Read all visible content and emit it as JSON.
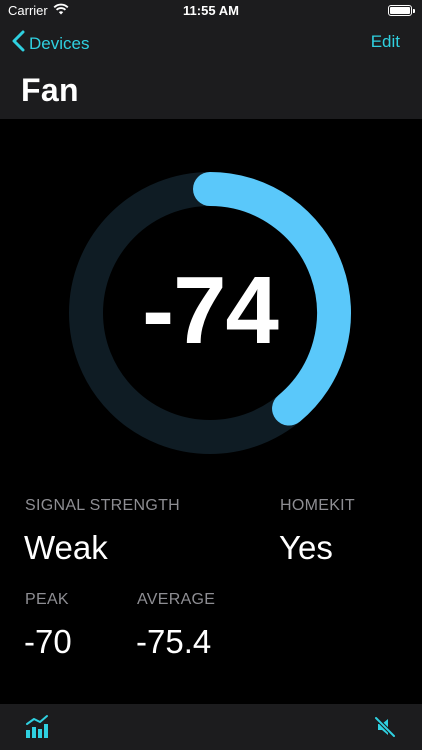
{
  "status": {
    "carrier": "Carrier",
    "time": "11:55 AM"
  },
  "nav": {
    "back_label": "Devices",
    "edit_label": "Edit",
    "title": "Fan"
  },
  "gauge": {
    "value": "-74",
    "progress": 0.39
  },
  "stats": {
    "signal_strength": {
      "label": "SIGNAL STRENGTH",
      "value": "Weak"
    },
    "homekit": {
      "label": "HOMEKIT",
      "value": "Yes"
    },
    "peak": {
      "label": "PEAK",
      "value": "-70"
    },
    "average": {
      "label": "AVERAGE",
      "value": "-75.4"
    }
  },
  "colors": {
    "accent": "#2fd0e0",
    "gauge_fill": "#5ac8fa",
    "gauge_track": "#0f1c24"
  },
  "tabbar": {
    "left_icon": "signal-chart-icon",
    "right_icon": "speaker-muted-icon"
  }
}
